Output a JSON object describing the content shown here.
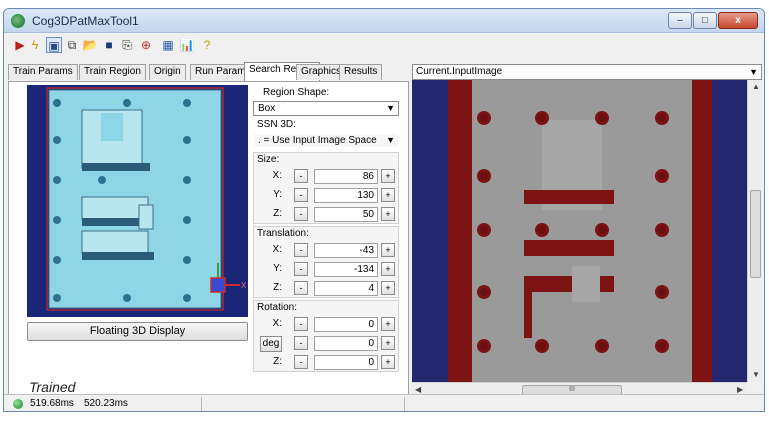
{
  "window": {
    "title": "Cog3DPatMaxTool1",
    "min_label": "–",
    "max_label": "□",
    "close_label": "x"
  },
  "toolbar": {
    "buttons": [
      {
        "name": "run-icon",
        "glyph": "▶",
        "color": "#b8201a"
      },
      {
        "name": "electric-icon",
        "glyph": "ϟ",
        "color": "#c89a00"
      },
      {
        "name": "show-image-icon",
        "glyph": "▣",
        "color": "#2b4a8a"
      },
      {
        "name": "reset-icon",
        "glyph": "⧉",
        "color": "#3a3a3a"
      },
      {
        "name": "open-icon",
        "glyph": "📂",
        "color": "#c8942a"
      },
      {
        "name": "save-icon",
        "glyph": "■",
        "color": "#1b3a7a"
      },
      {
        "name": "copy-icon",
        "glyph": "⎘",
        "color": "#333333"
      },
      {
        "name": "add-icon",
        "glyph": "⊕",
        "color": "#c0322b"
      },
      {
        "name": "image-icon",
        "glyph": "▦",
        "color": "#2a5aa8"
      },
      {
        "name": "chart-icon",
        "glyph": "📊",
        "color": "#2e7a3a"
      },
      {
        "name": "help-icon",
        "glyph": "?",
        "color": "#c8a000"
      }
    ]
  },
  "tabs": [
    {
      "label": "Train Params"
    },
    {
      "label": "Train Region"
    },
    {
      "label": "Origin"
    },
    {
      "label": "Run Params"
    },
    {
      "label": "Search Region",
      "active": true
    },
    {
      "label": "Graphics"
    },
    {
      "label": "Results"
    }
  ],
  "left": {
    "float_button": "Floating 3D Display",
    "trained_label": "Trained",
    "axis_y": "Y",
    "axis_x": "X"
  },
  "props": {
    "region_shape_label": "Region Shape:",
    "region_shape_value": "Box",
    "ssn_label": "SSN 3D:",
    "ssn_value": ". = Use Input Image Space",
    "size_label": "Size:",
    "size": [
      {
        "axis": "X:",
        "value": "86"
      },
      {
        "axis": "Y:",
        "value": "130"
      },
      {
        "axis": "Z:",
        "value": "50"
      }
    ],
    "translation_label": "Translation:",
    "translation": [
      {
        "axis": "X:",
        "value": "-43"
      },
      {
        "axis": "Y:",
        "value": "-134"
      },
      {
        "axis": "Z:",
        "value": "4"
      }
    ],
    "rotation_label": "Rotation:",
    "deg_label": "deg",
    "rotation": [
      {
        "axis": "X:",
        "value": "0"
      },
      {
        "axis": "Y:",
        "value": "0"
      },
      {
        "axis": "Z:",
        "value": "0"
      }
    ],
    "minus": "-",
    "plus": "+"
  },
  "right": {
    "image_select": "Current.InputImage",
    "hscroll_grip": "III"
  },
  "status": {
    "time1": "519.68ms",
    "time2": "520.23ms"
  },
  "colors": {
    "viewer_background": "#25276e",
    "red_band": "#7c1414",
    "gray_region": "#9a9a9a",
    "thumb_background": "#1a2678",
    "thumb_cyan": "#8ed6e6"
  }
}
